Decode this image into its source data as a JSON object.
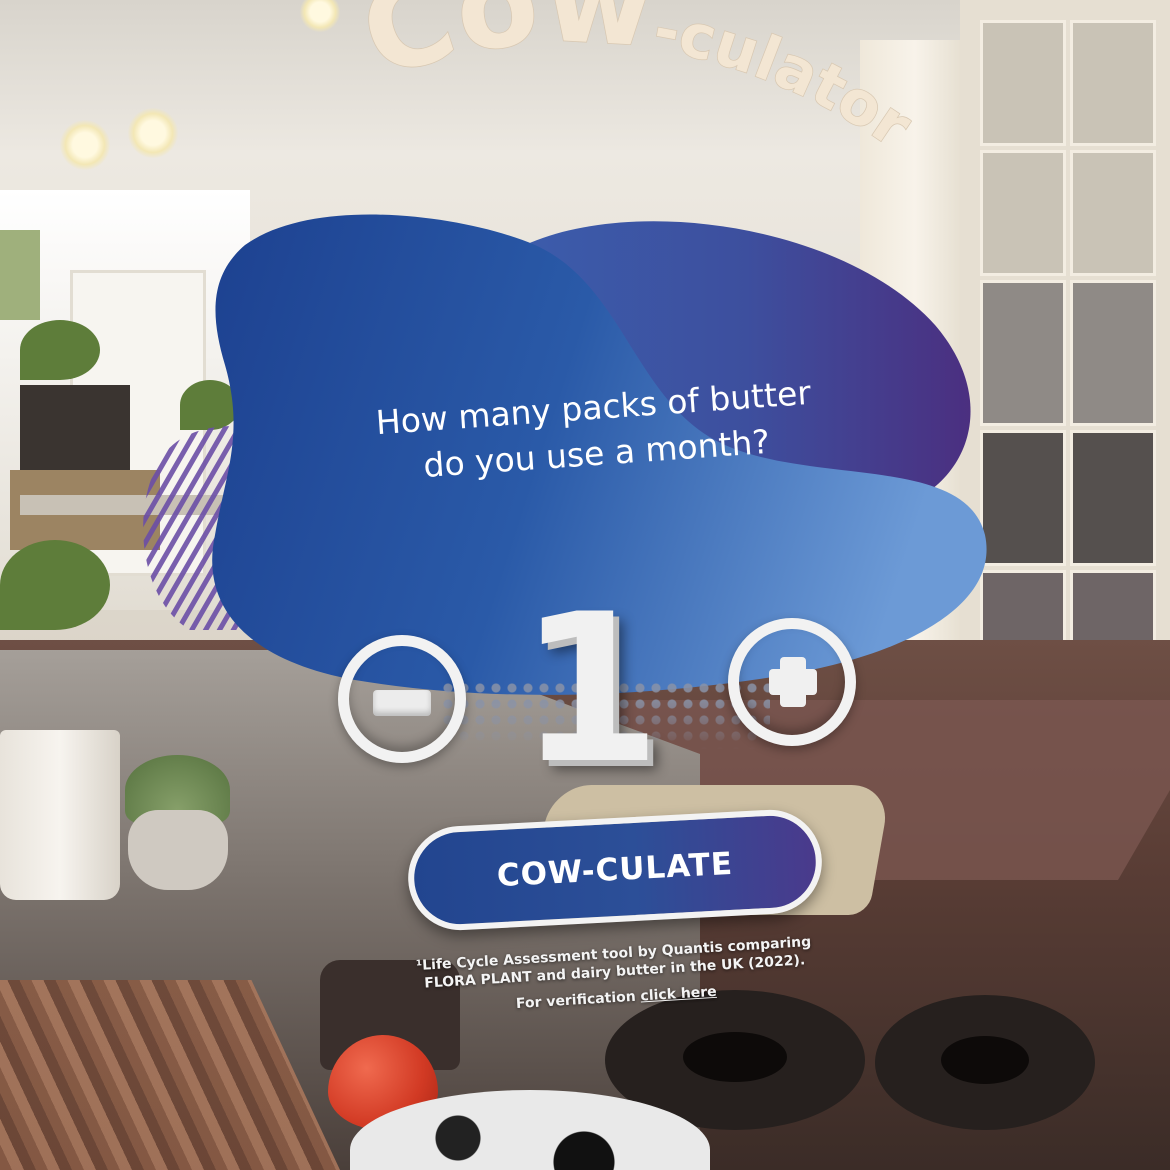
{
  "app": {
    "title_main": "Cow",
    "title_rest": "-culator"
  },
  "question": {
    "line1": "How many packs of butter",
    "line2": "do you use a month?"
  },
  "counter": {
    "value": "1",
    "minus_label": "-",
    "plus_label": "+"
  },
  "cta": {
    "label": "COW-CULATE"
  },
  "footnote": {
    "line1": "¹Life Cycle Assessment tool by Quantis comparing",
    "line2": "FLORA PLANT and dairy butter in the UK (2022).",
    "verify_prefix": "For verification",
    "verify_link": "click here"
  },
  "colors": {
    "title": "#f3e6d3",
    "blob_dark": "#1f4690",
    "blob_purple": "#4b3384",
    "blob_light": "#5f8fcf",
    "button": "#2a4a95",
    "white": "#ffffff"
  },
  "icons": [
    "minus-icon",
    "plus-icon"
  ]
}
